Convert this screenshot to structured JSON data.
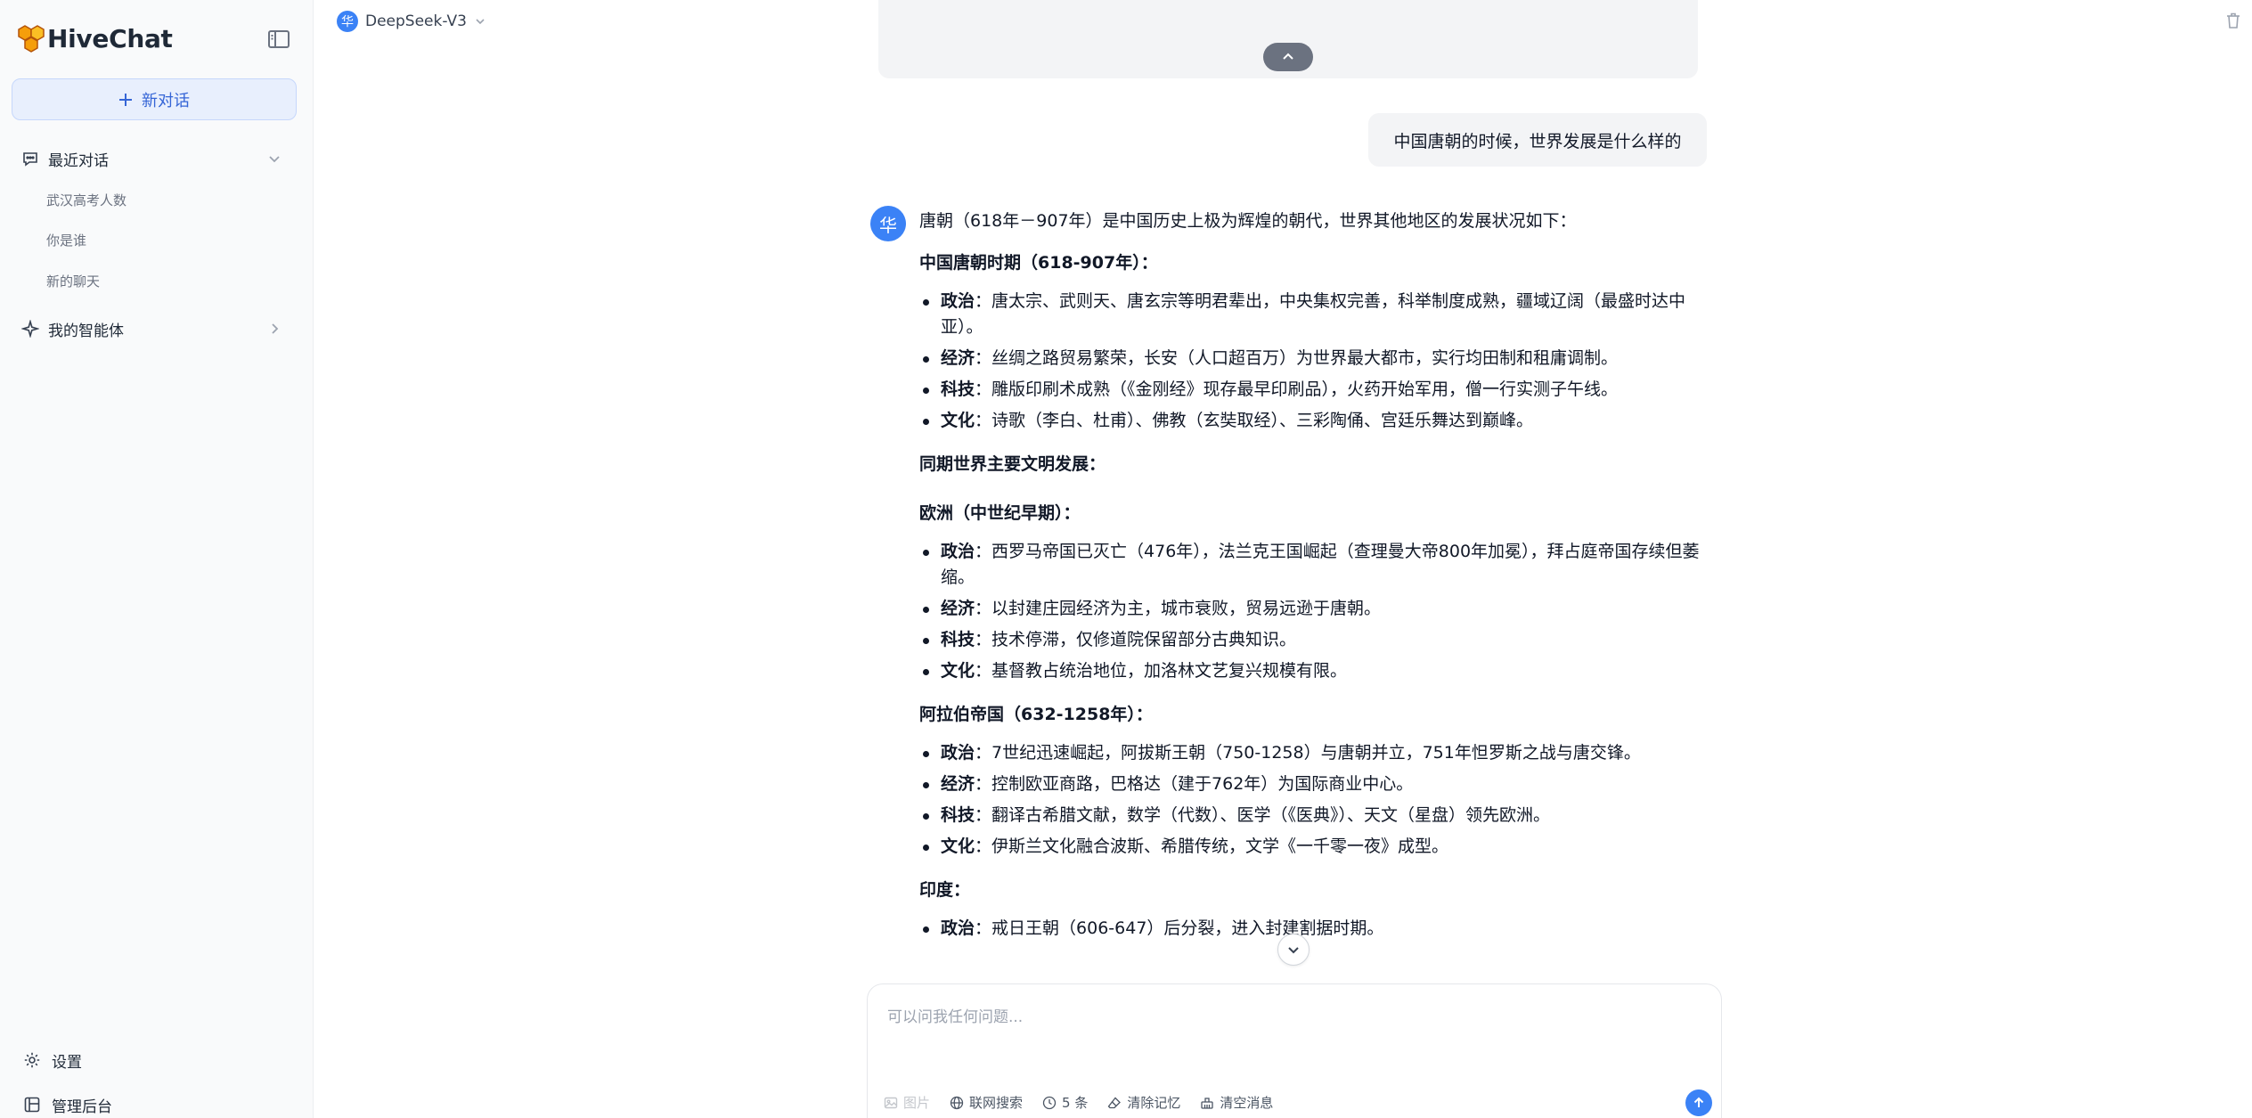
{
  "app": {
    "name": "HiveChat",
    "accent": "#3b82f6"
  },
  "sidebar": {
    "new_chat_label": "新对话",
    "recent_label": "最近对话",
    "history": [
      "武汉高考人数",
      "你是谁",
      "新的聊天"
    ],
    "agents_label": "我的智能体",
    "settings_label": "设置",
    "admin_label": "管理后台"
  },
  "header": {
    "model_badge": "华",
    "model_name": "DeepSeek-V3"
  },
  "chat": {
    "user_message": "中国唐朝的时候，世界发展是什么样的",
    "ai_avatar": "华",
    "intro": "唐朝（618年－907年）是中国历史上极为辉煌的朝代，世界其他地区的发展状况如下：",
    "sections": [
      {
        "heading": "中国唐朝时期（618-907年）：",
        "items": [
          {
            "label": "政治",
            "text": "：唐太宗、武则天、唐玄宗等明君辈出，中央集权完善，科举制度成熟，疆域辽阔（最盛时达中亚）。"
          },
          {
            "label": "经济",
            "text": "：丝绸之路贸易繁荣，长安（人口超百万）为世界最大都市，实行均田制和租庸调制。"
          },
          {
            "label": "科技",
            "text": "：雕版印刷术成熟（《金刚经》现存最早印刷品），火药开始军用，僧一行实测子午线。"
          },
          {
            "label": "文化",
            "text": "：诗歌（李白、杜甫）、佛教（玄奘取经）、三彩陶俑、宫廷乐舞达到巅峰。"
          }
        ]
      },
      {
        "heading": "同期世界主要文明发展：",
        "items": []
      },
      {
        "heading": "欧洲（中世纪早期）：",
        "items": [
          {
            "label": "政治",
            "text": "：西罗马帝国已灭亡（476年），法兰克王国崛起（查理曼大帝800年加冕），拜占庭帝国存续但萎缩。"
          },
          {
            "label": "经济",
            "text": "：以封建庄园经济为主，城市衰败，贸易远逊于唐朝。"
          },
          {
            "label": "科技",
            "text": "：技术停滞，仅修道院保留部分古典知识。"
          },
          {
            "label": "文化",
            "text": "：基督教占统治地位，加洛林文艺复兴规模有限。"
          }
        ]
      },
      {
        "heading": "阿拉伯帝国（632-1258年）：",
        "items": [
          {
            "label": "政治",
            "text": "：7世纪迅速崛起，阿拔斯王朝（750-1258）与唐朝并立，751年怛罗斯之战与唐交锋。"
          },
          {
            "label": "经济",
            "text": "：控制欧亚商路，巴格达（建于762年）为国际商业中心。"
          },
          {
            "label": "科技",
            "text": "：翻译古希腊文献，数学（代数）、医学（《医典》）、天文（星盘）领先欧洲。"
          },
          {
            "label": "文化",
            "text": "：伊斯兰文化融合波斯、希腊传统，文学《一千零一夜》成型。"
          }
        ]
      },
      {
        "heading": "印度：",
        "items": [
          {
            "label": "政治",
            "text": "：戒日王朝（606-647）后分裂，进入封建割据时期。"
          }
        ]
      }
    ]
  },
  "input": {
    "placeholder": "可以问我任何问题...",
    "tools": {
      "image": "图片",
      "web_search": "联网搜索",
      "history_count": "5 条",
      "clear_memory": "清除记忆",
      "clear_messages": "清空消息"
    }
  }
}
